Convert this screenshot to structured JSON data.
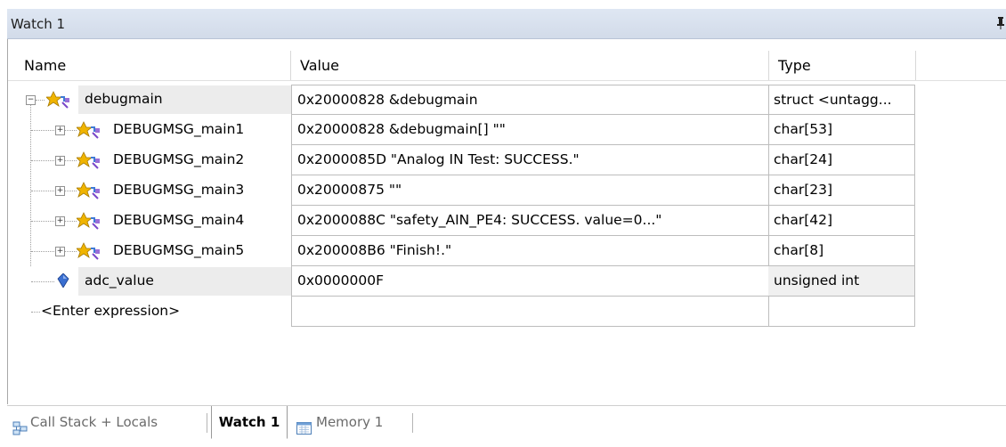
{
  "window": {
    "title": "Watch 1",
    "pin_icon": "pin-icon"
  },
  "columns": {
    "name": "Name",
    "value": "Value",
    "type": "Type"
  },
  "rows": [
    {
      "name": "debugmain",
      "value": "0x20000828 &debugmain",
      "type": "struct <untagg...",
      "level": 0,
      "expander": "−",
      "icon": "struct-variable-icon"
    },
    {
      "name": "DEBUGMSG_main1",
      "value": "0x20000828 &debugmain[] \"\"",
      "type": "char[53]",
      "level": 1,
      "expander": "+",
      "icon": "array-variable-icon"
    },
    {
      "name": "DEBUGMSG_main2",
      "value": "0x2000085D \"Analog IN Test: SUCCESS.\"",
      "type": "char[24]",
      "level": 1,
      "expander": "+",
      "icon": "array-variable-icon"
    },
    {
      "name": "DEBUGMSG_main3",
      "value": "0x20000875 \"\"",
      "type": "char[23]",
      "level": 1,
      "expander": "+",
      "icon": "array-variable-icon"
    },
    {
      "name": "DEBUGMSG_main4",
      "value": "0x2000088C \"safety_AIN_PE4: SUCCESS. value=0...\"",
      "type": "char[42]",
      "level": 1,
      "expander": "+",
      "icon": "array-variable-icon"
    },
    {
      "name": "DEBUGMSG_main5",
      "value": "0x200008B6 \"Finish!.\"",
      "type": "char[8]",
      "level": 1,
      "expander": "+",
      "icon": "array-variable-icon"
    },
    {
      "name": "adc_value",
      "value": "0x0000000F",
      "type": "unsigned int",
      "level": 0,
      "expander": "",
      "icon": "scalar-variable-icon"
    },
    {
      "name": "<Enter expression>",
      "value": "",
      "type": "",
      "level": 0,
      "expander": "",
      "icon": ""
    }
  ],
  "tabs": [
    {
      "label": "Call Stack + Locals",
      "icon": "call-stack-icon",
      "active": false
    },
    {
      "label": "Watch 1",
      "icon": "",
      "active": true
    },
    {
      "label": "Memory 1",
      "icon": "memory-icon",
      "active": false
    }
  ],
  "colors": {
    "title_bg": "#d8e0ee",
    "selected_name_bg": "#ececec",
    "grid": "#bdbdbd"
  }
}
